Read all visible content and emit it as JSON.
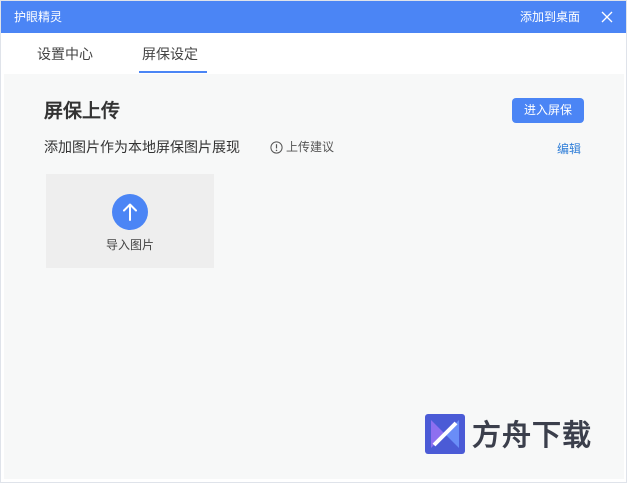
{
  "window": {
    "title": "护眼精灵",
    "add_to_desktop": "添加到桌面",
    "accent_color": "#4b85f5"
  },
  "tabs": [
    {
      "label": "设置中心",
      "active": false
    },
    {
      "label": "屏保设定",
      "active": true
    }
  ],
  "screensaver": {
    "section_title": "屏保上传",
    "enter_button": "进入屏保",
    "description": "添加图片作为本地屏保图片展现",
    "suggest_label": "上传建议",
    "edit_label": "编辑",
    "upload_label": "导入图片"
  },
  "watermark": {
    "text": "方舟下载"
  },
  "icons": [
    "close-icon",
    "info-icon",
    "upload-arrow-icon",
    "watermark-logo-icon"
  ]
}
